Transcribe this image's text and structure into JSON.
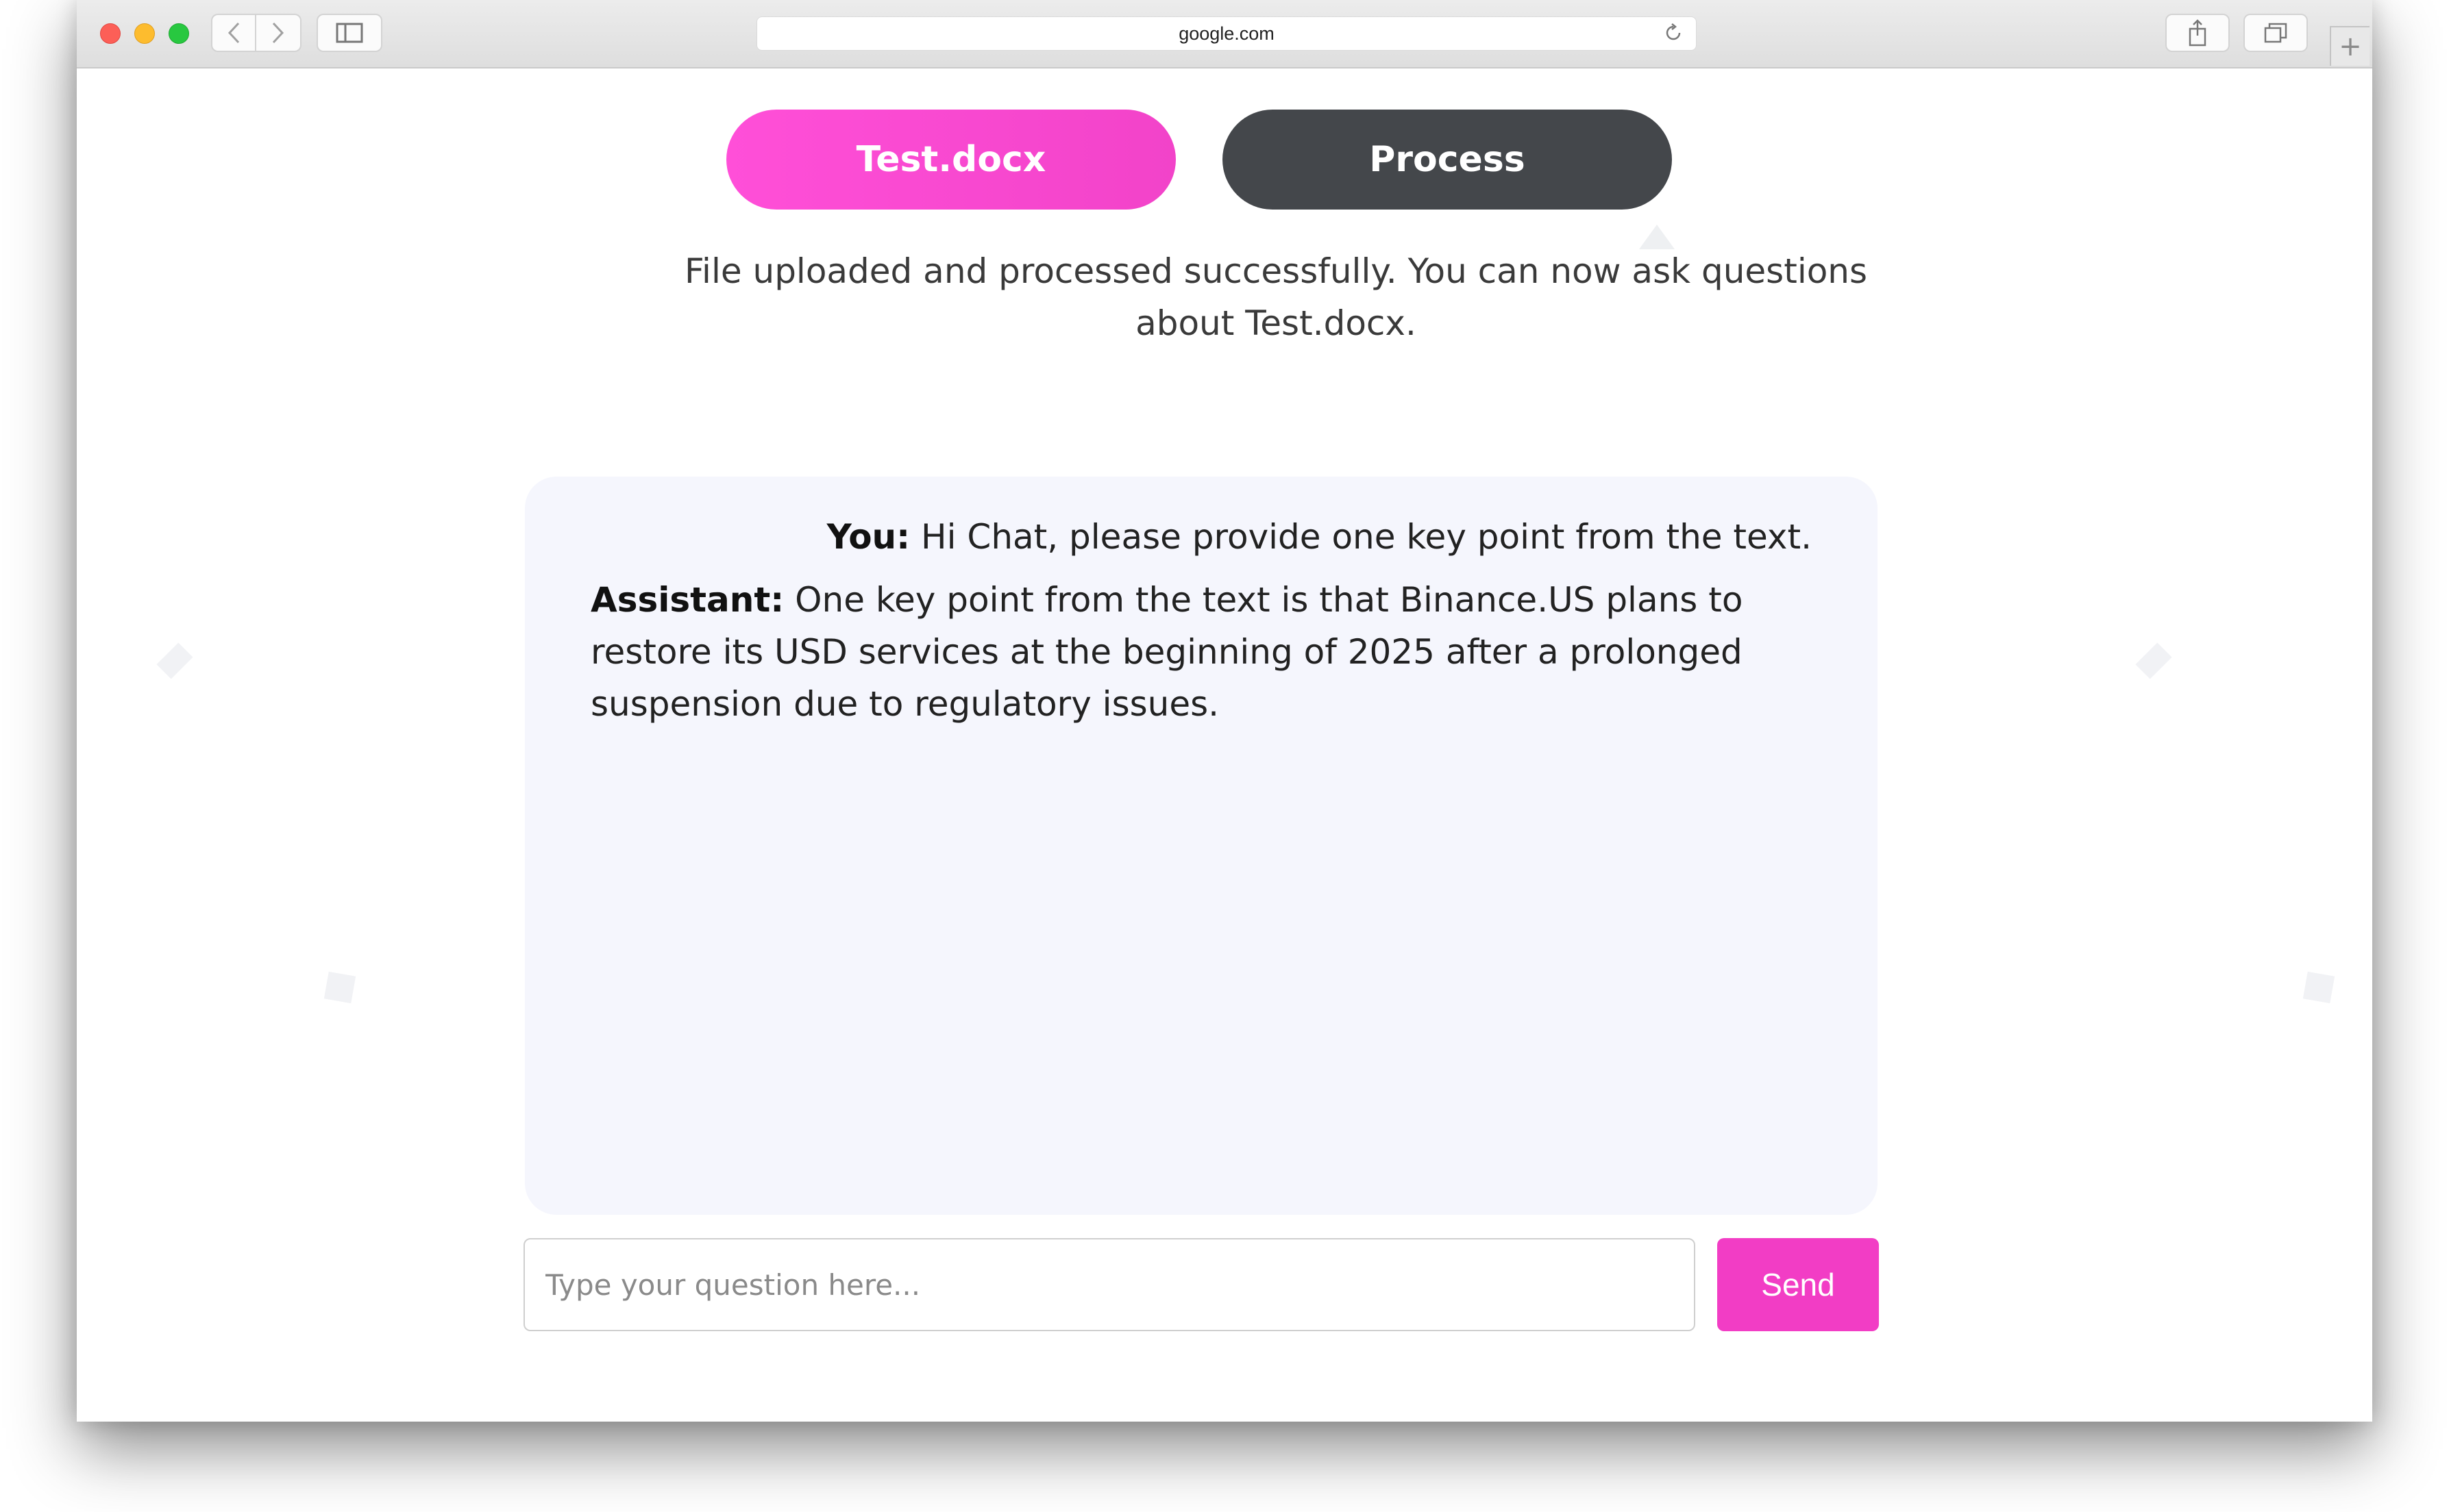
{
  "browser": {
    "url": "google.com",
    "back_icon": "chevron-left-icon",
    "forward_icon": "chevron-right-icon",
    "sidebar_icon": "sidebar-icon",
    "reload_icon": "reload-icon",
    "share_icon": "share-icon",
    "tabs_icon": "tabs-icon",
    "new_tab_icon": "plus-icon"
  },
  "upload": {
    "file_button_label": "Test.docx",
    "process_button_label": "Process",
    "status_text": "File uploaded and processed successfully. You can now ask questions about Test.docx."
  },
  "chat": {
    "messages": [
      {
        "role_label": "You:",
        "text": " Hi Chat, please provide one key point from the text."
      },
      {
        "role_label": "Assistant:",
        "text": " One key point from the text is that Binance.US plans to restore its USD services at the beginning of 2025 after a prolonged suspension due to regulatory issues."
      }
    ]
  },
  "composer": {
    "placeholder": "Type your question here...",
    "value": "",
    "send_label": "Send"
  },
  "colors": {
    "accent_pink": "#f23dc5",
    "process_dark": "#44474b",
    "chat_bg": "#f5f6fd"
  }
}
